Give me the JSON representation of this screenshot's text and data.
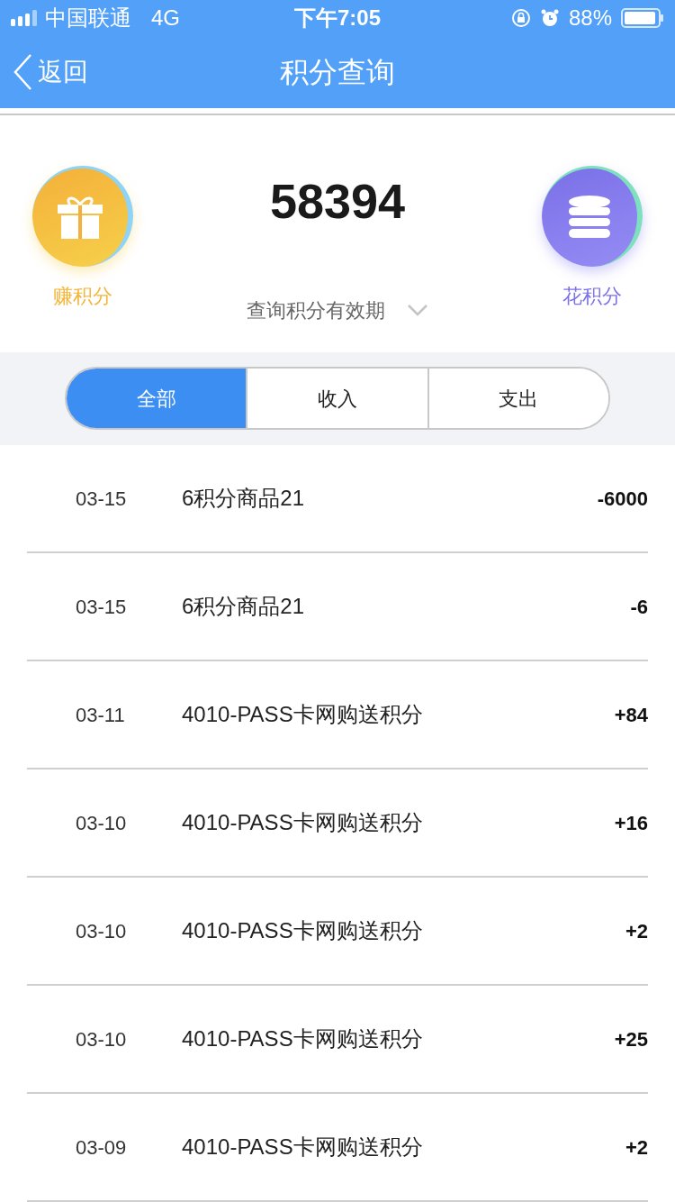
{
  "status_bar": {
    "carrier": "中国联通",
    "network": "4G",
    "time": "下午7:05",
    "battery": "88%"
  },
  "nav": {
    "back": "返回",
    "title": "积分查询"
  },
  "summary": {
    "earn": "赚积分",
    "points": "58394",
    "spend": "花积分",
    "validity": "查询积分有效期"
  },
  "tabs": [
    {
      "label": "全部",
      "selected": true
    },
    {
      "label": "收入",
      "selected": false
    },
    {
      "label": "支出",
      "selected": false
    }
  ],
  "records": [
    {
      "date": "03-15",
      "name": "6积分商品21",
      "amount": "-6000"
    },
    {
      "date": "03-15",
      "name": "6积分商品21",
      "amount": "-6"
    },
    {
      "date": "03-11",
      "name": "4010-PASS卡网购送积分",
      "amount": "+84"
    },
    {
      "date": "03-10",
      "name": "4010-PASS卡网购送积分",
      "amount": "+16"
    },
    {
      "date": "03-10",
      "name": "4010-PASS卡网购送积分",
      "amount": "+2"
    },
    {
      "date": "03-10",
      "name": "4010-PASS卡网购送积分",
      "amount": "+25"
    },
    {
      "date": "03-09",
      "name": "4010-PASS卡网购送积分",
      "amount": "+2"
    }
  ]
}
